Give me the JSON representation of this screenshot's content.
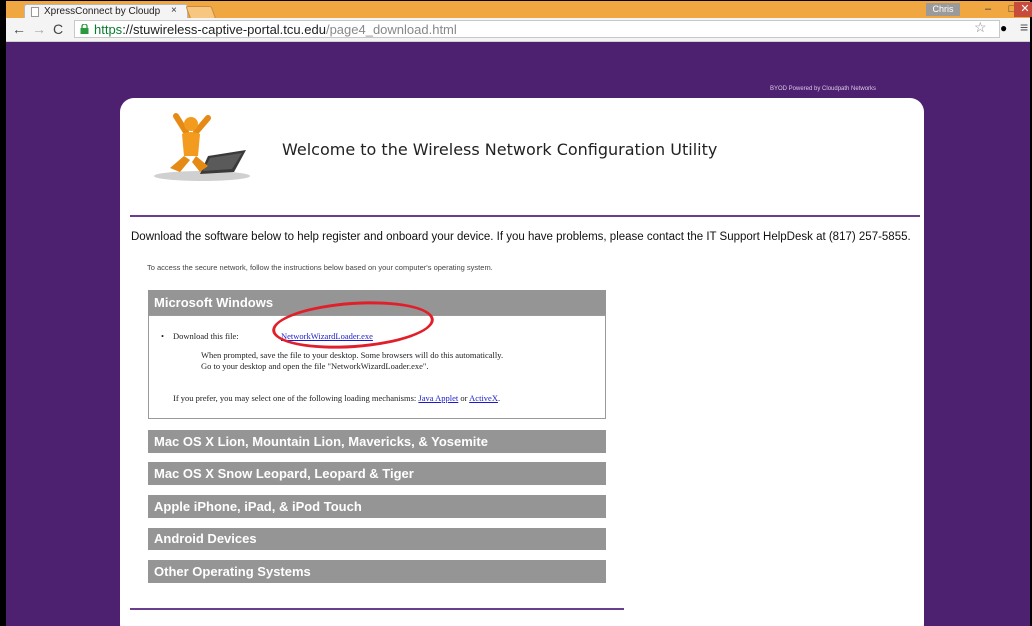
{
  "browser": {
    "tab_title": "XpressConnect by Cloudp",
    "tab_close": "×",
    "user_badge": "Chris",
    "url_scheme": "https",
    "url_host": "://stuwireless-captive-portal.tcu.edu",
    "url_path": "/page4_download.html"
  },
  "page": {
    "byod_text": "BYOD Powered by Cloudpath Networks",
    "welcome_title": "Welcome to the Wireless Network Configuration Utility",
    "intro": "Download the software below to help register and onboard your device. If you have problems, please contact the IT Support HelpDesk at (817) 257-5855.",
    "instructions": "To access the secure network, follow the instructions below based on your computer's operating system.",
    "sections": [
      "Microsoft Windows",
      "Mac OS X Lion, Mountain Lion, Mavericks, & Yosemite",
      "Mac OS X Snow Leopard, Leopard & Tiger",
      "Apple iPhone, iPad, & iPod Touch",
      "Android Devices",
      "Other Operating Systems"
    ],
    "windows": {
      "download_label": "Download this file:",
      "download_link": "NetworkWizardLoader.exe",
      "note1": "When prompted, save the file to your desktop. Some browsers will do this automatically.",
      "note2": "Go to your desktop and open the file \"NetworkWizardLoader.exe\".",
      "prefer_text": "If you prefer, you may select one of the following loading mechanisms:",
      "java_link": "Java Applet",
      "or_text": "or",
      "activex_link": "ActiveX"
    }
  },
  "colors": {
    "page_background": "#4e2170",
    "section_header": "#959595",
    "highlight": "#e11f2a",
    "link": "#1a1acc"
  }
}
